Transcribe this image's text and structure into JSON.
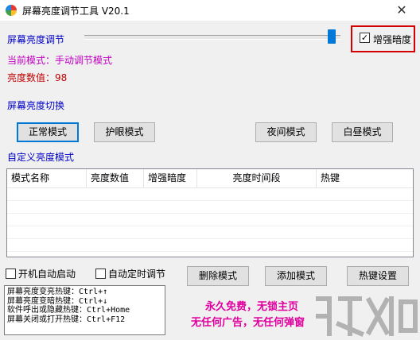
{
  "window": {
    "title": "屏幕亮度调节工具 V20.1",
    "close_glyph": "✕"
  },
  "brightness": {
    "label": "屏幕亮度调节",
    "slider_fraction": 0.98,
    "enhance_checkbox_label": "增强暗度",
    "enhance_checked": true,
    "current_mode_text": "当前模式：手动调节模式",
    "value_text": "亮度数值：98"
  },
  "mode_switch": {
    "label": "屏幕亮度切换",
    "buttons": [
      "正常模式",
      "护眼模式",
      "夜间模式",
      "白昼模式"
    ]
  },
  "custom": {
    "label": "自定义亮度模式",
    "columns": [
      "模式名称",
      "亮度数值",
      "增强暗度",
      "亮度时间段",
      "热键"
    ]
  },
  "options": {
    "autostart_label": "开机自动启动",
    "autotimer_label": "自动定时调节"
  },
  "actions": {
    "delete_label": "删除模式",
    "add_label": "添加模式",
    "hotkey_label": "热键设置"
  },
  "hotkeys": [
    "屏幕亮度变亮热键：Ctrl+↑",
    "屏幕亮度变暗热键：Ctrl+↓",
    "软件呼出或隐藏热键：Ctrl+Home",
    "屏幕关闭或打开热键：Ctrl+F12"
  ],
  "promo": {
    "line1": "永久免费，无锁主页",
    "line2": "无任何广告，无任何弹窗"
  },
  "colors": {
    "label_blue": "#0000c8",
    "mode_purple": "#c000c0",
    "value_red": "#c00000",
    "highlight_red": "#d40000",
    "promo_pink": "#e000a0",
    "slider_blue": "#0078d7"
  }
}
